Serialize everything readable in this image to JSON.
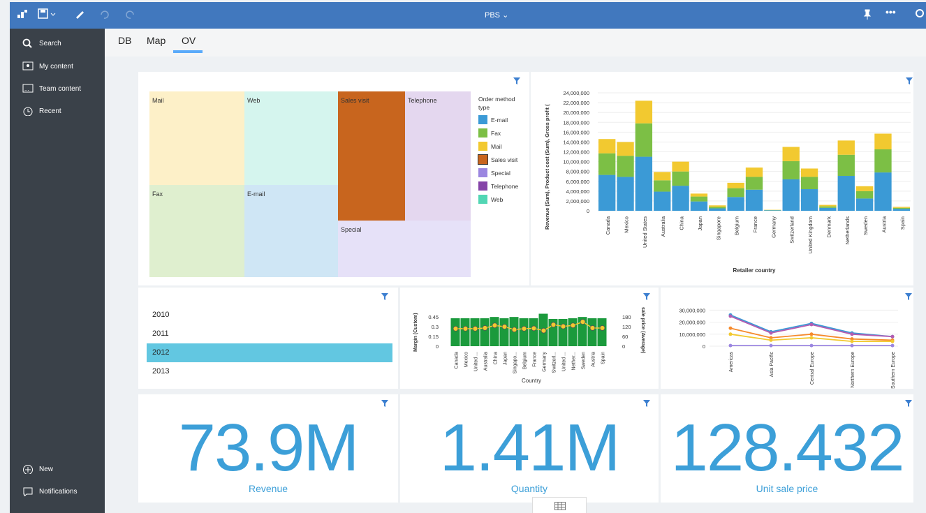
{
  "toolbar": {
    "title": "PBS"
  },
  "sidebar": {
    "items": [
      {
        "label": "Search"
      },
      {
        "label": "My content"
      },
      {
        "label": "Team content"
      },
      {
        "label": "Recent"
      }
    ],
    "bottom": [
      {
        "label": "New"
      },
      {
        "label": "Notifications"
      }
    ]
  },
  "tabs": [
    {
      "label": "DB"
    },
    {
      "label": "Map"
    },
    {
      "label": "OV"
    }
  ],
  "treemap": {
    "legend_title": "Order method type",
    "legend": [
      {
        "label": "E-mail",
        "color": "#3b9ad6"
      },
      {
        "label": "Fax",
        "color": "#7cbf45"
      },
      {
        "label": "Mail",
        "color": "#f2c930"
      },
      {
        "label": "Sales visit",
        "color": "#c8651e"
      },
      {
        "label": "Special",
        "color": "#9b86e0"
      },
      {
        "label": "Telephone",
        "color": "#8544a8"
      },
      {
        "label": "Web",
        "color": "#52d6b4"
      }
    ],
    "cells": [
      {
        "label": "Mail"
      },
      {
        "label": "Web"
      },
      {
        "label": "Sales visit"
      },
      {
        "label": "Telephone"
      },
      {
        "label": "Fax"
      },
      {
        "label": "E-mail"
      },
      {
        "label": "Special"
      }
    ]
  },
  "chart_data": [
    {
      "type": "bar",
      "stacked": true,
      "ylabel": "Revenue (Sum), Product cost (Sum), Gross profit (",
      "xlabel": "Retailer country",
      "yticks": [
        "24,000,000",
        "22,000,000",
        "20,000,000",
        "18,000,000",
        "16,000,000",
        "14,000,000",
        "12,000,000",
        "10,000,000",
        "8,000,000",
        "6,000,000",
        "4,000,000",
        "2,000,000",
        "0"
      ],
      "categories": [
        "Canada",
        "Mexico",
        "United States",
        "Australia",
        "China",
        "Japan",
        "Singapore",
        "Belgium",
        "France",
        "Germany",
        "Switzerland",
        "United Kingdom",
        "Denmark",
        "Netherlands",
        "Sweden",
        "Austria",
        "Spain"
      ],
      "series": [
        {
          "color": "#3b9ad6",
          "values": [
            7.3,
            6.9,
            11.0,
            3.9,
            5.1,
            1.9,
            0.5,
            2.8,
            4.3,
            0.1,
            6.4,
            4.4,
            0.6,
            7.1,
            2.5,
            7.8,
            0.4
          ]
        },
        {
          "color": "#7cbf45",
          "values": [
            4.4,
            4.3,
            6.8,
            2.3,
            2.9,
            1.0,
            0.3,
            1.8,
            2.6,
            0.05,
            3.7,
            2.5,
            0.3,
            4.3,
            1.5,
            4.7,
            0.2
          ]
        },
        {
          "color": "#f2c930",
          "values": [
            2.9,
            2.8,
            4.6,
            1.7,
            2.0,
            0.6,
            0.3,
            1.1,
            1.9,
            0.05,
            2.9,
            1.7,
            0.3,
            2.9,
            1.0,
            3.2,
            0.2
          ]
        }
      ]
    },
    {
      "type": "bar",
      "ylabel": "Margin (Custom)",
      "y2label": "sale price (Average)",
      "xlabel": "Country",
      "yticks": [
        "0.45",
        "0.3",
        "0.15",
        "0"
      ],
      "y2ticks": [
        "180",
        "120",
        "60",
        "0"
      ],
      "categories": [
        "Canada",
        "Mexico",
        "United ...",
        "Australia",
        "China",
        "Japan",
        "Singapo...",
        "Belgium",
        "France",
        "Germany",
        "Switzerl...",
        "United ...",
        "Nether...",
        "Sweden",
        "Austria",
        "Spain"
      ],
      "values": [
        0.43,
        0.43,
        0.43,
        0.43,
        0.45,
        0.43,
        0.45,
        0.43,
        0.43,
        0.5,
        0.42,
        0.42,
        0.43,
        0.45,
        0.43,
        0.43
      ],
      "line": [
        108,
        108,
        108,
        112,
        128,
        120,
        102,
        108,
        110,
        96,
        132,
        122,
        128,
        150,
        112,
        112
      ],
      "color": "#1b9a3c",
      "line_color": "#f2c930"
    },
    {
      "type": "line",
      "yticks": [
        "30,000,000",
        "20,000,000",
        "10,000,000",
        "0"
      ],
      "categories": [
        "Americas",
        "Asia Pacific",
        "Central Europe",
        "Northern Europe",
        "Southern Europe"
      ],
      "series": [
        {
          "color": "#3b9ad6",
          "values": [
            26,
            12,
            19,
            11,
            8
          ]
        },
        {
          "color": "#b35bb1",
          "values": [
            25,
            11,
            18,
            10,
            8
          ]
        },
        {
          "color": "#f68a2c",
          "values": [
            15,
            7,
            10,
            6,
            5
          ]
        },
        {
          "color": "#f2c930",
          "values": [
            10,
            5,
            7,
            4,
            4
          ]
        },
        {
          "color": "#9b86e0",
          "values": [
            0.5,
            0.5,
            0.5,
            0.5,
            0.5
          ]
        }
      ]
    }
  ],
  "years": [
    {
      "label": "2010"
    },
    {
      "label": "2011"
    },
    {
      "label": "2012"
    },
    {
      "label": "2013"
    }
  ],
  "kpis": [
    {
      "value": "73.9M",
      "label": "Revenue"
    },
    {
      "value": "1.41M",
      "label": "Quantity"
    },
    {
      "value": "128.432",
      "label": "Unit sale price"
    }
  ]
}
